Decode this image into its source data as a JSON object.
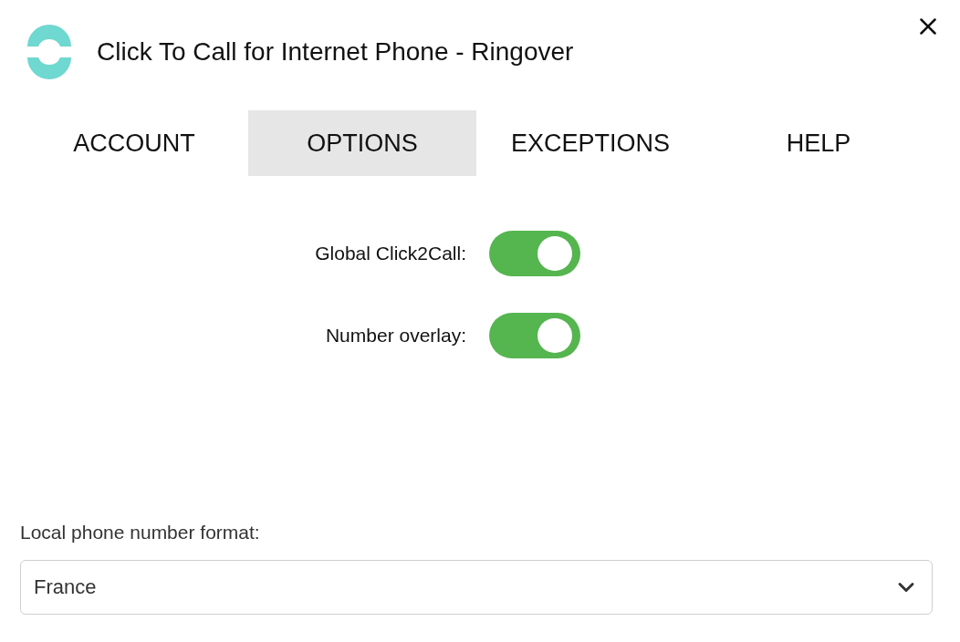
{
  "window": {
    "title": "Click To Call for Internet Phone - Ringover"
  },
  "tabs": [
    {
      "label": "ACCOUNT",
      "selected": false
    },
    {
      "label": "OPTIONS",
      "selected": true
    },
    {
      "label": "EXCEPTIONS",
      "selected": false
    },
    {
      "label": "HELP",
      "selected": false
    }
  ],
  "toggles": [
    {
      "label": "Global Click2Call:",
      "on": true
    },
    {
      "label": "Number overlay:",
      "on": true
    }
  ],
  "format": {
    "label": "Local phone number format:",
    "value": "France"
  }
}
